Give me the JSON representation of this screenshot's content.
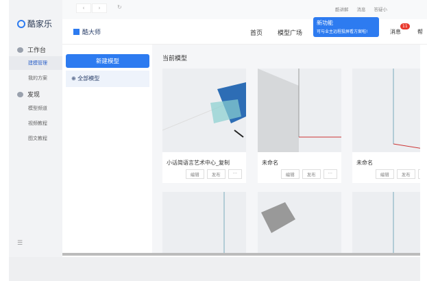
{
  "sidebar": {
    "brand": "酷家乐",
    "groups": [
      {
        "label": "工作台",
        "items": [
          "建模管理",
          "我的方案"
        ]
      },
      {
        "label": "发现",
        "items": [
          "模型频道",
          "视频教程",
          "图文教程"
        ]
      }
    ],
    "menu_icon": "list-icon"
  },
  "topbar": {
    "links": [
      "酷讲解",
      "消息",
      "答疑小"
    ]
  },
  "header": {
    "brand": "酷大师",
    "nav": [
      "首页",
      "模型广场"
    ],
    "messages": "消息",
    "badge": "11",
    "more": "帮"
  },
  "tooltip": {
    "title": "新功能",
    "text": "可与业主远程投屏看方案啦!"
  },
  "leftpanel": {
    "new_button": "新建模型",
    "all_models": "全部模型"
  },
  "main": {
    "title": "当前模型",
    "cards": [
      {
        "name": "小话简语言艺术中心_复制"
      },
      {
        "name": "未命名"
      },
      {
        "name": "未命名"
      }
    ],
    "actions": [
      "编辑",
      "发布",
      "···"
    ]
  },
  "colors": {
    "accent": "#2d7bf0"
  }
}
